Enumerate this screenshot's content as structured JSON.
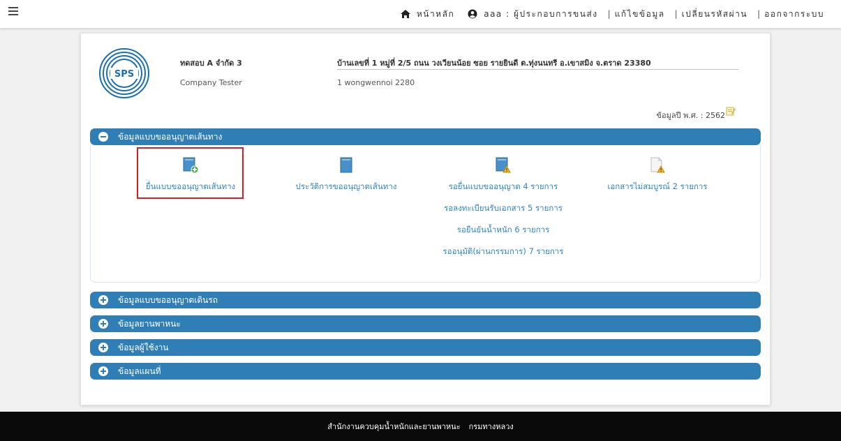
{
  "navbar": {
    "home_label": "หน้าหลัก",
    "user_label": "aaa : ผู้ประกอบการขนส่ง",
    "edit_profile_label": "แก้ไขข้อมูล",
    "change_password_label": "เปลี่ยนรหัสผ่าน",
    "logout_label": "ออกจากระบบ",
    "separator": "|"
  },
  "company": {
    "logo_text": "SPS",
    "name_th": "ทดสอบ A จำกัด 3",
    "name_en": "Company Tester",
    "address_th": "บ้านเลขที่ 1 หมู่ที่ 2/5 ถนน วงเวียนน้อย ซอย รายยินดี ต.ทุ่งนนทรี อ.เขาสมิง จ.ตราด 23380",
    "address_en": "1 wongwennoi 2280",
    "year_label": "ข้อมูลปี พ.ศ. : 2562"
  },
  "sections": [
    {
      "label": "ข้อมูลแบบขออนุญาตเส้นทาง",
      "expanded": true
    },
    {
      "label": "ข้อมูลแบบขออนุญาตเดินรถ",
      "expanded": false
    },
    {
      "label": "ข้อมูลยานพาหนะ",
      "expanded": false
    },
    {
      "label": "ข้อมูลผู้ใช้งาน",
      "expanded": false
    },
    {
      "label": "ข้อมูลแผนที่",
      "expanded": false
    }
  ],
  "route_panel": {
    "submit_request": "ยื่นแบบขออนุญาตเส้นทาง",
    "request_history": "ประวัติการขออนุญาตเส้นทาง",
    "pending": [
      "รอยื่นแบบขออนุญาต 4 รายการ",
      "รอลงทะเบียนรับเอกสาร 5 รายการ",
      "รอยืนยันน้ำหนัก 6 รายการ",
      "รออนุมัติ(ผ่านกรรมการ) 7 รายการ"
    ],
    "incomplete_docs": "เอกสารไม่สมบูรณ์ 2 รายการ",
    "icons": [
      "doc-add-icon",
      "doc-history-icon",
      "doc-warning-icon",
      "doc-incomplete-icon"
    ]
  },
  "footer": {
    "org1": "สำนักงานควบคุมน้ำหนักและยานพาหนะ",
    "org2": "กรมทางหลวง"
  },
  "colors": {
    "accent": "#2f7fb6",
    "link": "#2d86c4",
    "highlight": "#d81f1f",
    "footer_bg": "#0a0a0a"
  }
}
